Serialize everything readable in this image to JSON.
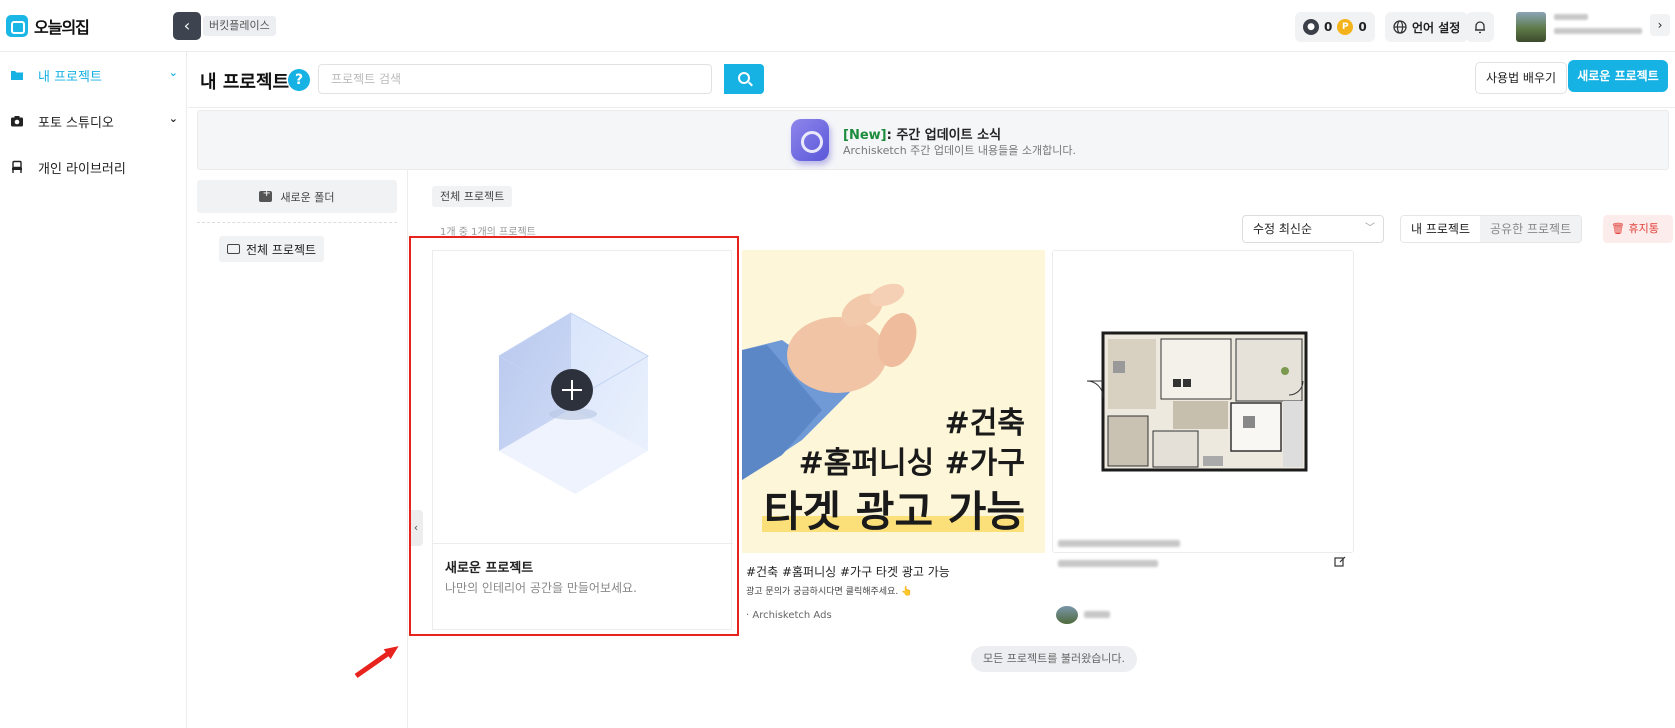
{
  "app": {
    "logo_text": "오늘의집"
  },
  "topbar": {
    "breadcrumb": "버킷플레이스",
    "points_dark": "0",
    "points_gold": "0",
    "language_label": "언어 설정"
  },
  "sidebar": {
    "items": [
      {
        "label": "내 프로젝트",
        "icon": "folder-icon",
        "active": true,
        "expandable": true
      },
      {
        "label": "포토 스튜디오",
        "icon": "camera-icon",
        "active": false,
        "expandable": true
      },
      {
        "label": "개인 라이브러리",
        "icon": "chair-icon",
        "active": false,
        "expandable": false
      }
    ]
  },
  "header": {
    "title": "내 프로젝트",
    "search_placeholder": "프로젝트 검색",
    "learn_label": "사용법 배우기",
    "new_project_label": "새로운 프로젝트"
  },
  "banner": {
    "new_tag": "[New]",
    "title": ": 주간 업데이트 소식",
    "subtitle": "Archisketch 주간 업데이트 내용들을 소개합니다."
  },
  "folders": {
    "new_folder_label": "새로운 폴더",
    "all_projects_label": "전체 프로젝트"
  },
  "projects": {
    "filter_chip": "전체 프로젝트",
    "count_text": "1개 중 1개의 프로젝트",
    "sort_value": "수정 최신순",
    "segment_mine": "내 프로젝트",
    "segment_shared": "공유한 프로젝트",
    "trash_label": "휴지통",
    "loaded_text": "모든 프로젝트를 불러왔습니다."
  },
  "cards": {
    "new_card": {
      "title": "새로운 프로젝트",
      "subtitle": "나만의 인테리어 공간을 만들어보세요."
    },
    "ad_card": {
      "line1": "#건축",
      "line2": "#홈퍼니싱 #가구",
      "line3": "타겟 광고 가능",
      "title": "#건축 #홈퍼니싱 #가구 타겟 광고 가능",
      "desc": "광고 문의가 궁금하시다면 클릭해주세요. 👆",
      "source": "· Archisketch Ads"
    }
  },
  "colors": {
    "accent": "#16b2e3",
    "annotation": "#e8231d",
    "trash": "#e0423a"
  }
}
